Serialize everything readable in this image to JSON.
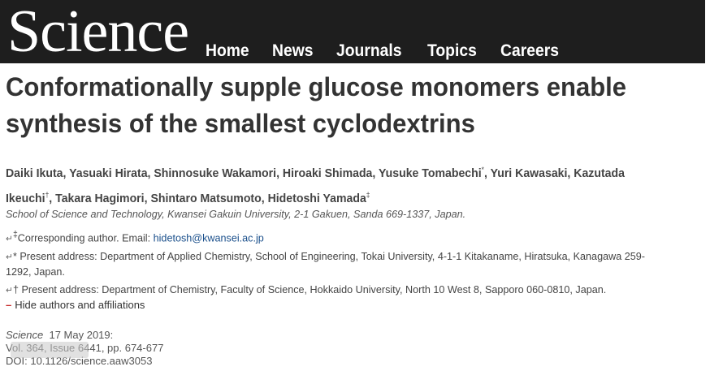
{
  "header": {
    "logo": "Science",
    "nav": [
      "Home",
      "News",
      "Journals",
      "Topics",
      "Careers"
    ]
  },
  "article": {
    "title": "Conformationally supple glucose monomers enable synthesis of the smallest cyclodextrins",
    "authors": [
      {
        "name": "Daiki Ikuta",
        "mark": ""
      },
      {
        "name": "Yasuaki Hirata",
        "mark": ""
      },
      {
        "name": "Shinnosuke Wakamori",
        "mark": ""
      },
      {
        "name": "Hiroaki Shimada",
        "mark": ""
      },
      {
        "name": "Yusuke Tomabechi",
        "mark": "*"
      },
      {
        "name": "Yuri Kawasaki",
        "mark": ""
      },
      {
        "name": "Kazutada Ikeuchi",
        "mark": "†"
      },
      {
        "name": "Takara Hagimori",
        "mark": ""
      },
      {
        "name": "Shintaro Matsumoto",
        "mark": ""
      },
      {
        "name": "Hidetoshi Yamada",
        "mark": "‡"
      }
    ],
    "affiliation": "School of Science and Technology, Kwansei Gakuin University, 2-1 Gakuen, Sanda 669-1337, Japan.",
    "corresponding": {
      "return_icon": "↵",
      "mark": "‡",
      "label": "Corresponding author. Email: ",
      "email": "hidetosh@kwansei.ac.jp"
    },
    "note_star": {
      "return_icon": "↵",
      "mark": "*",
      "text": " Present address: Department of Applied Chemistry, School of Engineering, Tokai University, 4-1-1 Kitakaname, Hiratsuka, Kanagawa 259-1292, Japan."
    },
    "note_dagger": {
      "return_icon": "↵",
      "mark": "†",
      "text": " Present address: Department of Chemistry, Faculty of Science, Hokkaido University, North 10 West 8, Sapporo 060-0810, Japan."
    },
    "hide_toggle": {
      "symbol": "–",
      "label": "Hide authors and affiliations"
    },
    "publication": {
      "journal": "Science",
      "date": "17 May 2019:",
      "volume": "Vol. 364, Issue 6441, pp. 674-677",
      "doi": "DOI: 10.1126/science.aaw3053"
    }
  }
}
